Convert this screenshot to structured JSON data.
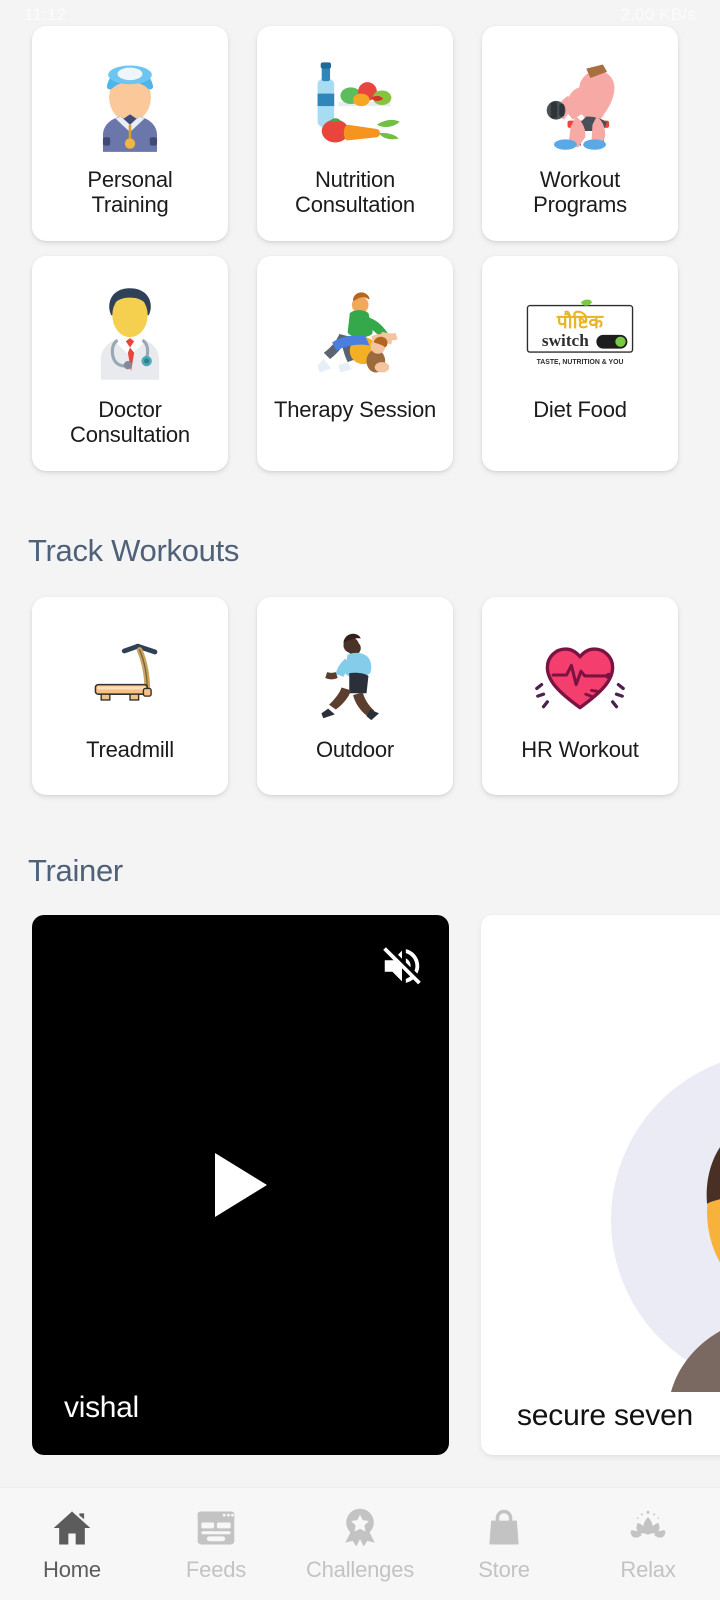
{
  "statusbar": {
    "left": "11:12",
    "right": "2.00 KB/s"
  },
  "services": {
    "items": [
      {
        "label": "Personal\nTraining",
        "icon": "trainer-whistle-icon"
      },
      {
        "label": "Nutrition\nConsultation",
        "icon": "vegetables-bottle-icon"
      },
      {
        "label": "Workout\nPrograms",
        "icon": "dumbbell-bench-icon"
      },
      {
        "label": "Doctor\nConsultation",
        "icon": "doctor-stethoscope-icon"
      },
      {
        "label": "Therapy Session",
        "icon": "physiotherapy-icon"
      },
      {
        "label": "Diet Food",
        "icon": "paushtik-switch-logo-icon"
      }
    ]
  },
  "diet_logo": {
    "title": "पौष्टिक",
    "subtitle": "switch",
    "tagline": "TASTE, NUTRITION & YOU"
  },
  "track_workouts": {
    "title": "Track Workouts",
    "items": [
      {
        "label": "Treadmill",
        "icon": "treadmill-icon"
      },
      {
        "label": "Outdoor",
        "icon": "runner-icon"
      },
      {
        "label": "HR Workout",
        "icon": "heart-rate-icon"
      }
    ]
  },
  "trainer": {
    "title": "Trainer",
    "cards": [
      {
        "name": "vishal",
        "type": "video",
        "muted": true
      },
      {
        "name": "secure seven",
        "type": "avatar"
      }
    ]
  },
  "bottom_nav": {
    "items": [
      {
        "label": "Home",
        "icon": "home-icon",
        "active": true
      },
      {
        "label": "Feeds",
        "icon": "feeds-icon",
        "active": false
      },
      {
        "label": "Challenges",
        "icon": "award-ribbon-icon",
        "active": false
      },
      {
        "label": "Store",
        "icon": "shopping-bag-icon",
        "active": false
      },
      {
        "label": "Relax",
        "icon": "lotus-icon",
        "active": false
      }
    ]
  },
  "colors": {
    "background": "#f4f4f4",
    "card": "#ffffff",
    "heading": "#4e6179",
    "nav_active": "#5c5c5c",
    "nav_inactive": "#c3c3c3",
    "video_bg": "#000000"
  }
}
